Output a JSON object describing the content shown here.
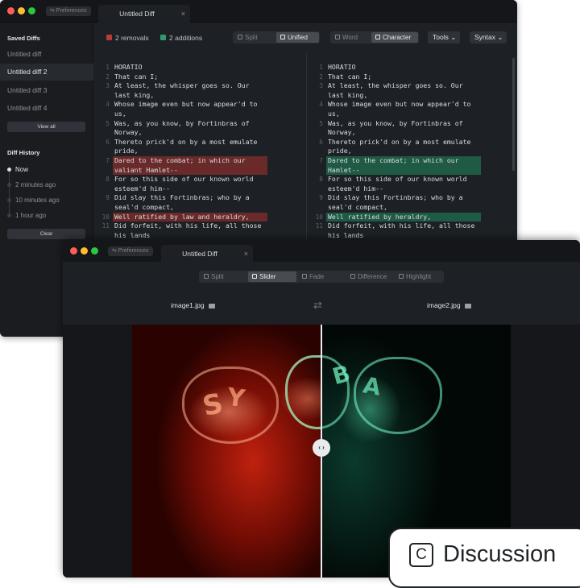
{
  "window1": {
    "preferences": "⇆ Preferences",
    "tab_title": "Untitled Diff",
    "tab_close": "×",
    "sidebar": {
      "saved_heading": "Saved Diffs",
      "saved": [
        "Untitled diff",
        "Untitled diff 2",
        "Untitled diff 3",
        "Untitled diff 4"
      ],
      "active_index": 1,
      "view_all": "View all",
      "history_heading": "Diff History",
      "history": [
        "Now",
        "2 minutes ago",
        "10 minutes ago",
        "1 hour ago"
      ],
      "clear": "Clear"
    },
    "toolbar": {
      "removals": "2 removals",
      "additions": "2 additions",
      "removal_color": "#b83b3b",
      "addition_color": "#2e9b6e",
      "view_split": "Split",
      "view_unified": "Unified",
      "mode_word": "Word",
      "mode_character": "Character",
      "tools": "Tools ⌄",
      "syntax": "Syntax ⌄"
    },
    "left_lines": [
      {
        "n": "1",
        "t": "HORATIO"
      },
      {
        "n": "2",
        "t": "That can I;"
      },
      {
        "n": "3",
        "t": "At least, the whisper goes so. Our"
      },
      {
        "n": "",
        "t": "last king,"
      },
      {
        "n": "4",
        "t": "Whose image even but now appear'd to"
      },
      {
        "n": "",
        "t": "us,"
      },
      {
        "n": "5",
        "t": "Was, as you know, by Fortinbras of"
      },
      {
        "n": "",
        "t": "Norway,"
      },
      {
        "n": "6",
        "t": "Thereto prick'd on by a most emulate"
      },
      {
        "n": "",
        "t": "pride,"
      },
      {
        "n": "7",
        "t": "Dared to the combat; in which our",
        "hl": "del"
      },
      {
        "n": "",
        "t": "valiant Hamlet--",
        "hl": "del"
      },
      {
        "n": "8",
        "t": "For so this side of our known world"
      },
      {
        "n": "",
        "t": "esteem'd him--"
      },
      {
        "n": "9",
        "t": "Did slay this Fortinbras; who by a"
      },
      {
        "n": "",
        "t": "seal'd compact,"
      },
      {
        "n": "10",
        "t": "Well ratified by law and heraldry,",
        "hl": "del"
      },
      {
        "n": "11",
        "t": "Did forfeit, with his life, all those"
      },
      {
        "n": "",
        "t": "his lands"
      }
    ],
    "right_lines": [
      {
        "n": "1",
        "t": "HORATIO"
      },
      {
        "n": "2",
        "t": "That can I;"
      },
      {
        "n": "3",
        "t": "At least, the whisper goes so. Our"
      },
      {
        "n": "",
        "t": "last king,"
      },
      {
        "n": "4",
        "t": "Whose image even but now appear'd to"
      },
      {
        "n": "",
        "t": "us,"
      },
      {
        "n": "5",
        "t": "Was, as you know, by Fortinbras of"
      },
      {
        "n": "",
        "t": "Norway,"
      },
      {
        "n": "6",
        "t": "Thereto prick'd on by a most emulate"
      },
      {
        "n": "",
        "t": "pride,"
      },
      {
        "n": "7",
        "t": "Dared to the combat; in which our",
        "hl": "add"
      },
      {
        "n": "",
        "t": "Hamlet--",
        "hl": "add"
      },
      {
        "n": "8",
        "t": "For so this side of our known world"
      },
      {
        "n": "",
        "t": "esteem'd him--"
      },
      {
        "n": "9",
        "t": "Did slay this Fortinbras; who by a"
      },
      {
        "n": "",
        "t": "seal'd compact,"
      },
      {
        "n": "10",
        "t": "Well ratified by heraldry,",
        "hl": "add"
      },
      {
        "n": "11",
        "t": "Did forfeit, with his life, all those"
      },
      {
        "n": "",
        "t": "his lands"
      }
    ]
  },
  "window2": {
    "preferences": "⇆ Preferences",
    "tab_title": "Untitled Diff",
    "tab_close": "×",
    "modes": [
      "Split",
      "Slider",
      "Fade",
      "Difference",
      "Highlight"
    ],
    "active_mode": "Slider",
    "left_file": "image1.jpg",
    "right_file": "image2.jpg",
    "swap_icon": "⇄",
    "slider_position": 0.5,
    "slider_knob": "‹ ›",
    "left_tint": "#c0210e",
    "right_tint": "#0b3a2c"
  },
  "badge": {
    "icon": "C",
    "label": "Discussion"
  }
}
